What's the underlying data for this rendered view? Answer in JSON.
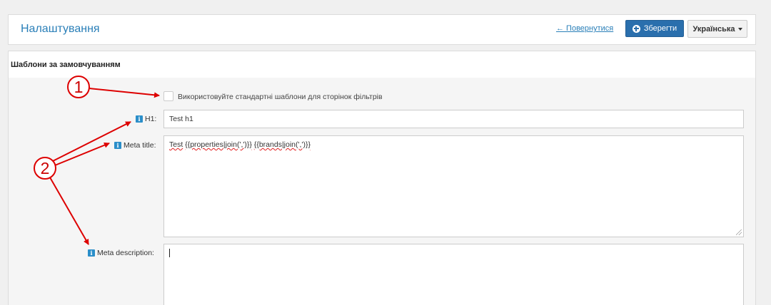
{
  "header": {
    "title": "Налаштування",
    "back_label": "← Повернутися",
    "save_label": "Зберегти",
    "language_label": "Українська"
  },
  "panel": {
    "title": "Шаблони за замовчуванням",
    "checkbox": {
      "label": "Використовуйте стандартні шаблони для сторінок фільтрів",
      "checked": false
    },
    "fields": {
      "h1": {
        "label": "H1:",
        "value": "Test h1"
      },
      "meta_title": {
        "label": "Meta title:",
        "prefix": "Test",
        "tokens": [
          "{{properties|join(',')}}",
          "{{brands|join(',')}}"
        ]
      },
      "meta_description": {
        "label": "Meta description:",
        "value": ""
      }
    }
  },
  "annotations": {
    "marker_1": "1",
    "marker_2": "2",
    "color": "#dd0000"
  },
  "colors": {
    "accent": "#2a7fb8",
    "primary_button": "#2a6fad",
    "info_icon": "#2a8ec9"
  }
}
